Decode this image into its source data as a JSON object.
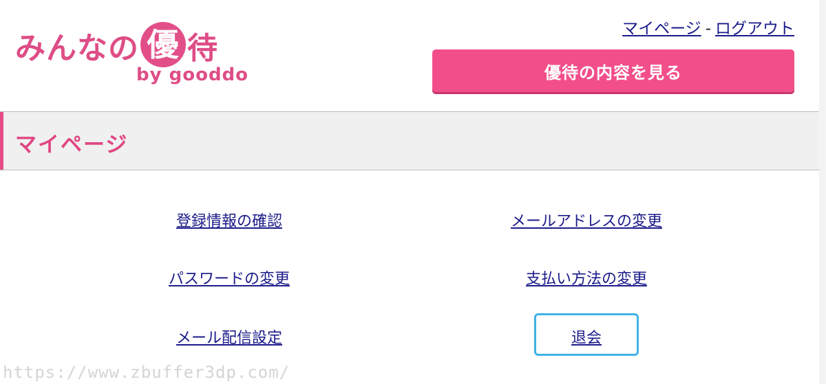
{
  "logo": {
    "text_before": "みんなの",
    "seal_char": "優",
    "text_after": "待",
    "sub": "by gooddo"
  },
  "header": {
    "mypage_link": "マイページ",
    "separator": "-",
    "logout_link": "ログアウト",
    "view_button": "優待の内容を見る"
  },
  "section": {
    "title": "マイページ"
  },
  "menu": {
    "items": [
      "登録情報の確認",
      "メールアドレスの変更",
      "パスワードの変更",
      "支払い方法の変更",
      "メール配信設定",
      "退会"
    ]
  },
  "watermark": "https://www.zbuffer3dp.com/",
  "colors": {
    "brand_pink": "#de4d86",
    "button_pink": "#f24f89",
    "link_blue": "#1b1b8a",
    "highlight_blue": "#3fb3e6"
  }
}
